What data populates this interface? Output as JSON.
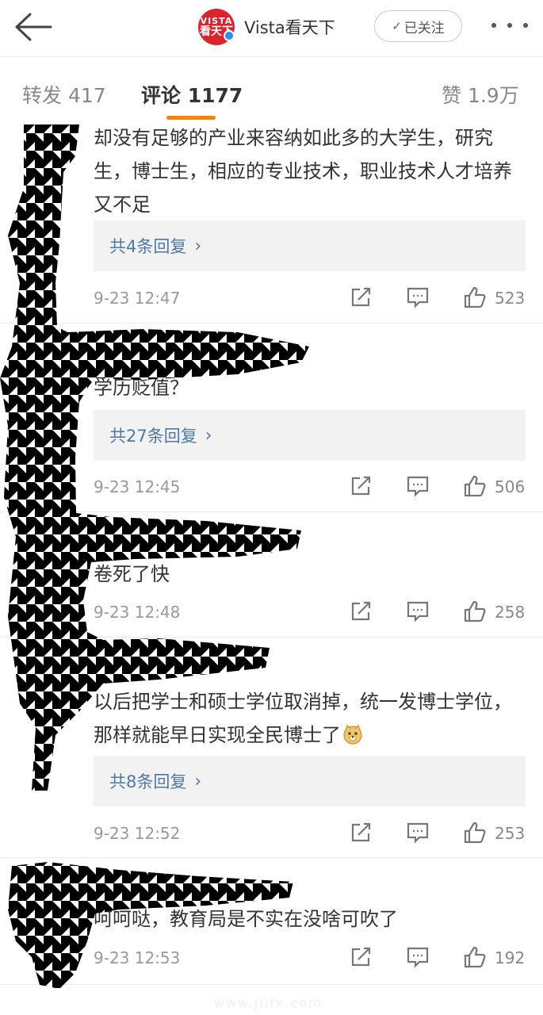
{
  "header": {
    "back_icon": "arrow-left-icon",
    "avatar_text_top": "VISTA",
    "avatar_text_bottom": "看天下",
    "account_name": "Vista看天下",
    "follow_label": "已关注",
    "more_icon": "more-dots-icon"
  },
  "tabs": {
    "repost": "转发 417",
    "comments": "评论 1177",
    "likes": "赞 1.9万",
    "active_color": "#ff8200"
  },
  "comments": [
    {
      "text": "却没有足够的产业来容纳如此多的大学生，研究生，博士生，相应的专业技术，职业技术人才培养又不足",
      "replies": "共4条回复",
      "time": "9-23 12:47",
      "likes": "523"
    },
    {
      "text": "学历贬值？",
      "replies": "共27条回复",
      "time": "9-23 12:45",
      "likes": "506"
    },
    {
      "text": "卷死了快",
      "replies": "",
      "time": "9-23 12:48",
      "likes": "258"
    },
    {
      "text": "以后把学士和硕士学位取消掉，统一发博士学位，那样就能早日实现全民博士了",
      "emoji": "doge",
      "replies": "共8条回复",
      "time": "9-23 12:52",
      "likes": "253"
    },
    {
      "text": "呵呵哒，教育局是不实在没啥可吹了",
      "replies": "",
      "time": "9-23 12:53",
      "likes": "192"
    }
  ],
  "colors": {
    "link": "#4d79a7",
    "verified": "#2c8ff0",
    "avatar_bg": "#d9232d"
  }
}
